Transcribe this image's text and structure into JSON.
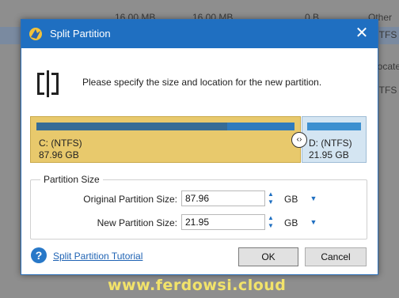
{
  "background": {
    "rows": [
      {
        "col1": "16.00 MB",
        "col2": "16.00 MB",
        "col3": "0 B",
        "col4": "Other"
      },
      {
        "col4": "NTFS"
      },
      {
        "col4": "Locate"
      },
      {
        "col4": "NTFS"
      }
    ]
  },
  "dialog": {
    "title": "Split Partition",
    "close_label": "✕",
    "instruction": "Please specify the size and location for the new partition.",
    "partitions": {
      "c": {
        "name": "C: (NTFS)",
        "size": "87.96 GB",
        "used_fraction": 0.74
      },
      "d": {
        "name": "D: (NTFS)",
        "size": "21.95 GB"
      },
      "handle_label": "‹›"
    },
    "partition_size": {
      "legend": "Partition Size",
      "original_label": "Original Partition Size:",
      "original_value": "87.96",
      "new_label": "New Partition Size:",
      "new_value": "21.95",
      "unit": "GB"
    },
    "help_label": "?",
    "tutorial_link": "Split Partition Tutorial",
    "ok_label": "OK",
    "cancel_label": "Cancel"
  },
  "watermark": "www.ferdowsi.cloud",
  "colors": {
    "titlebar": "#1f6fc1",
    "partition_c": "#e8c96c",
    "partition_d": "#d4e5f2"
  }
}
